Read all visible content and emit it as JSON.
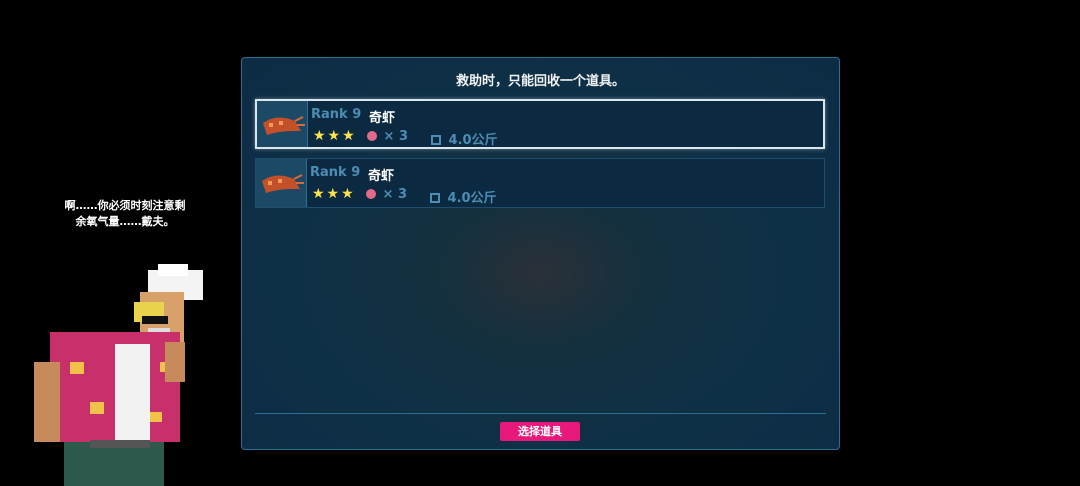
{
  "dialog": {
    "speech_line1": "啊……你必须时刻注意剩",
    "speech_line2": "余氧气量……戴夫。"
  },
  "panel": {
    "title": "救助时，只能回收一个道具。",
    "items": [
      {
        "rank": "Rank 9",
        "name": "奇虾",
        "stars": "★★★",
        "quantity": "× 3",
        "weight": "4.0公斤",
        "selected": true,
        "icon": "shrimp-icon"
      },
      {
        "rank": "Rank 9",
        "name": "奇虾",
        "stars": "★★★",
        "quantity": "× 3",
        "weight": "4.0公斤",
        "selected": false,
        "icon": "shrimp-icon"
      }
    ],
    "select_button": "选择道具"
  },
  "colors": {
    "accent_pink": "#e8197a",
    "star": "#ffe34d",
    "rank_blue": "#4c8db3"
  }
}
